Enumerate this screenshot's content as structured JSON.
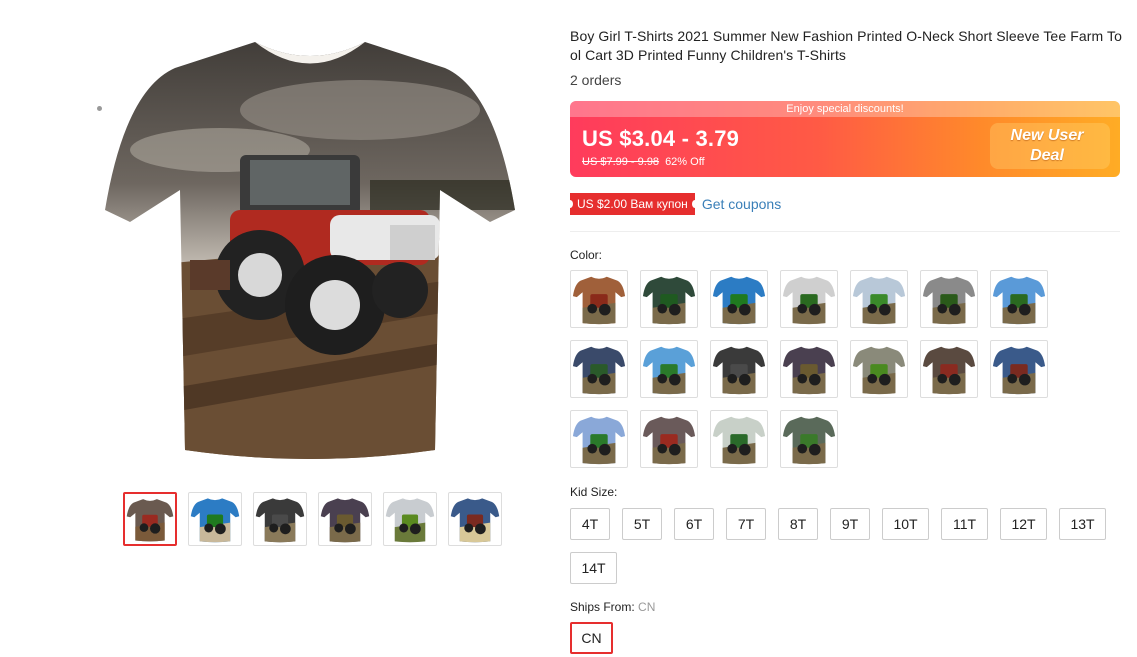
{
  "product": {
    "title": "Boy Girl T-Shirts 2021 Summer New Fashion Printed O-Neck Short Sleeve Tee Farm Tool Cart 3D Printed Funny Children's T-Shirts",
    "orders": "2 orders"
  },
  "price": {
    "banner": "Enjoy special discounts!",
    "current": "US $3.04 - 3.79",
    "original": "US $7.99 - 9.98",
    "discount": "62% Off",
    "deal_line1": "New User",
    "deal_line2": "Deal"
  },
  "coupon": {
    "tag": "US $2.00 Вам купон",
    "link": "Get coupons"
  },
  "color": {
    "label": "Color:",
    "swatches": [
      {
        "sky": "#a0603a",
        "tractor": "#8a2a1a"
      },
      {
        "sky": "#2f4a3a",
        "tractor": "#1f5a20"
      },
      {
        "sky": "#2c7cc4",
        "tractor": "#1f7a1f"
      },
      {
        "sky": "#cfcfcf",
        "tractor": "#2a6a20"
      },
      {
        "sky": "#b8c8d8",
        "tractor": "#3a8a2a"
      },
      {
        "sky": "#8a8a8a",
        "tractor": "#2a5a1a"
      },
      {
        "sky": "#5a9ad8",
        "tractor": "#2a6a20"
      },
      {
        "sky": "#3a4a6a",
        "tractor": "#2a5a2a"
      },
      {
        "sky": "#5aa0d8",
        "tractor": "#2a7a2a"
      },
      {
        "sky": "#3a3a3a",
        "tractor": "#4a4a4a"
      },
      {
        "sky": "#4a4050",
        "tractor": "#6a5a30"
      },
      {
        "sky": "#8a8a7a",
        "tractor": "#4a8a20"
      },
      {
        "sky": "#5a4a40",
        "tractor": "#8a2a20"
      },
      {
        "sky": "#3a5a8a",
        "tractor": "#7a2a20"
      },
      {
        "sky": "#8aa8d8",
        "tractor": "#2a7a2a"
      },
      {
        "sky": "#6a5a5a",
        "tractor": "#9a2a20"
      },
      {
        "sky": "#c8d0c8",
        "tractor": "#2a6a2a"
      },
      {
        "sky": "#5a6a5a",
        "tractor": "#3a7a2a"
      }
    ]
  },
  "kid_size": {
    "label": "Kid Size:",
    "options": [
      "4T",
      "5T",
      "6T",
      "7T",
      "8T",
      "9T",
      "10T",
      "11T",
      "12T",
      "13T",
      "14T"
    ]
  },
  "ships_from": {
    "label": "Ships From:",
    "value": "CN",
    "option": "CN"
  },
  "gallery": {
    "thumbnails": [
      {
        "sky": "#6a5a50",
        "tractor": "#9a2a20",
        "ground": "#7a5a3a"
      },
      {
        "sky": "#2c7cc4",
        "tractor": "#1f7a1f",
        "ground": "#c8b89a"
      },
      {
        "sky": "#3a3a3a",
        "tractor": "#4a4a4a",
        "ground": "#8a7a5a"
      },
      {
        "sky": "#4a4050",
        "tractor": "#6a5a30",
        "ground": "#7a6a4a"
      },
      {
        "sky": "#c8ccd0",
        "tractor": "#5a8a20",
        "ground": "#6a7a3a"
      },
      {
        "sky": "#3a5a8a",
        "tractor": "#7a2a20",
        "ground": "#d8c898"
      }
    ]
  }
}
